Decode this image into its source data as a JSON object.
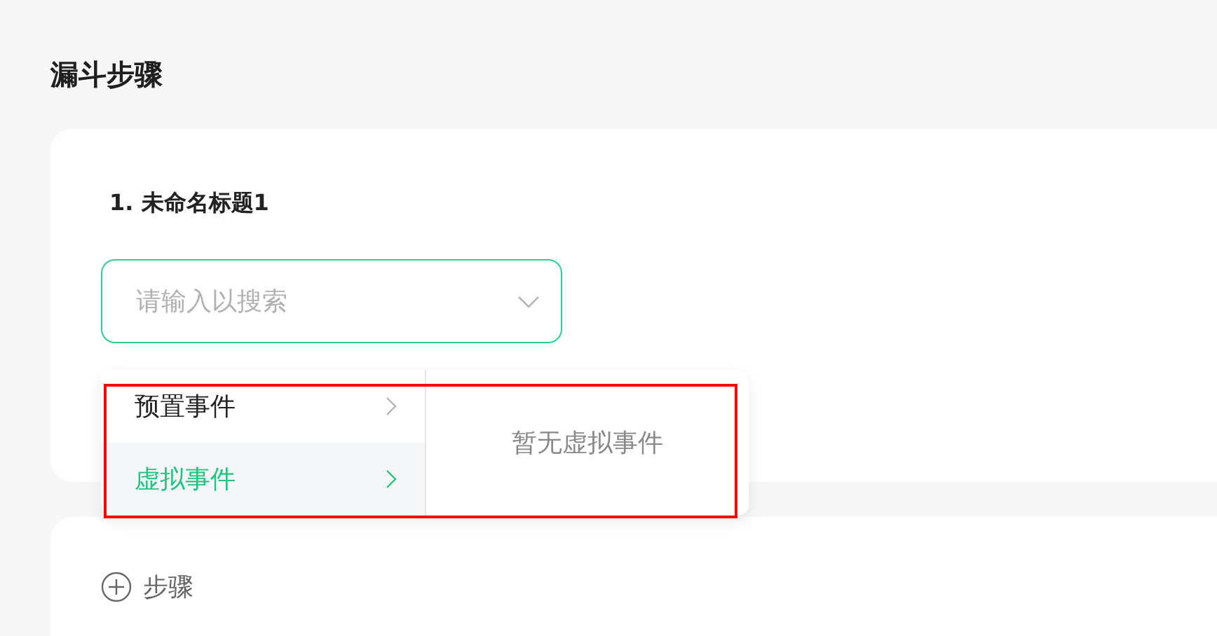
{
  "section_title": "漏斗步骤",
  "steps": [
    {
      "title": "1. 未命名标题1",
      "select": {
        "placeholder": "请输入以搜索"
      }
    }
  ],
  "dropdown": {
    "categories": [
      {
        "label": "预置事件",
        "selected": false
      },
      {
        "label": "虚拟事件",
        "selected": true
      }
    ],
    "empty_text": "暂无虚拟事件"
  },
  "add_step": {
    "label": "步骤"
  }
}
